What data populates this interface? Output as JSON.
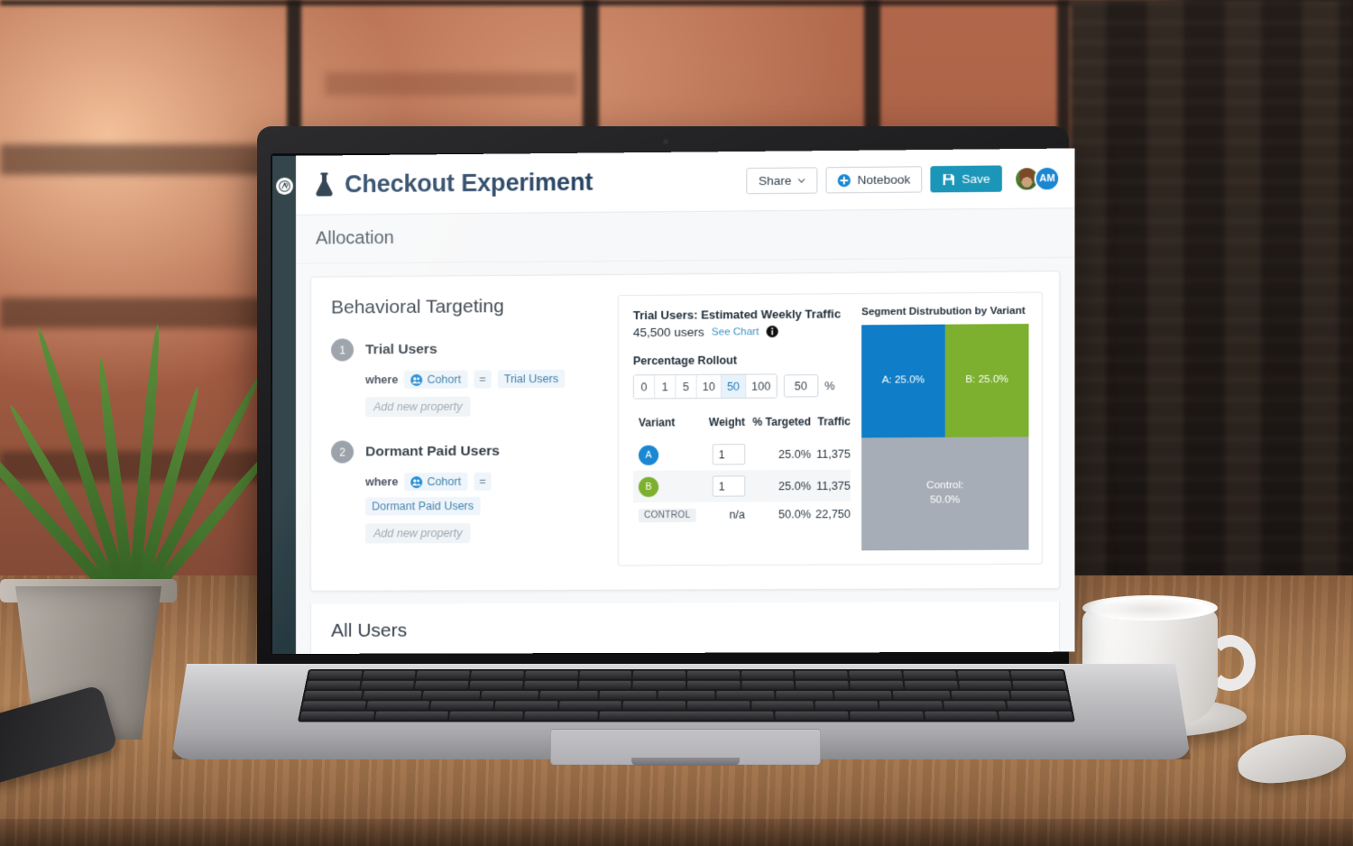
{
  "rail": {
    "logo_label": "A"
  },
  "header": {
    "title": "Checkout Experiment",
    "flask_icon": "flask-icon",
    "share_label": "Share",
    "notebook_label": "Notebook",
    "save_label": "Save",
    "avatars": [
      {
        "name": "avatar-photo",
        "initials": ""
      },
      {
        "name": "avatar-am",
        "initials": "AM"
      }
    ],
    "accent_save": "#1c96b8",
    "accent_title": "#1b3a5c"
  },
  "section": {
    "title": "Allocation"
  },
  "targeting": {
    "heading": "Behavioral Targeting",
    "rules": [
      {
        "step": "1",
        "name": "Trial Users",
        "keyword": "where",
        "property": "Cohort",
        "operator": "=",
        "value": "Trial Users",
        "add_property": "Add new property"
      },
      {
        "step": "2",
        "name": "Dormant Paid Users",
        "keyword": "where",
        "property": "Cohort",
        "operator": "=",
        "value": "Dormant Paid Users",
        "add_property": "Add new property"
      }
    ]
  },
  "allocation": {
    "traffic_heading": "Trial Users: Estimated Weekly Traffic",
    "traffic_users": "45,500 users",
    "see_chart": "See Chart",
    "info_icon": "info-icon",
    "rollout_label": "Percentage Rollout",
    "rollout_options": [
      "0",
      "1",
      "5",
      "10",
      "50",
      "100"
    ],
    "rollout_selected": "50",
    "rollout_input_value": "50",
    "rollout_unit": "%",
    "table": {
      "columns": [
        "Variant",
        "Weight",
        "% Targeted",
        "Traffic"
      ],
      "rows": [
        {
          "variant": "A",
          "type": "dot",
          "color": "#1b87d2",
          "weight": "1",
          "weight_editable": true,
          "targeted": "25.0%",
          "traffic": "11,375"
        },
        {
          "variant": "B",
          "type": "dot",
          "color": "#7cb02e",
          "weight": "1",
          "weight_editable": true,
          "targeted": "25.0%",
          "traffic": "11,375"
        },
        {
          "variant": "CONTROL",
          "type": "pill",
          "color": "#eef1f4",
          "weight": "n/a",
          "weight_editable": false,
          "targeted": "50.0%",
          "traffic": "22,750"
        }
      ]
    }
  },
  "chart_data": {
    "type": "treemap",
    "title": "Segment Distrubution by Variant",
    "categories": [
      "A",
      "B",
      "Control"
    ],
    "values": [
      25.0,
      25.0,
      50.0
    ],
    "labels": [
      "A: 25.0%",
      "B: 25.0%",
      "Control:\n50.0%"
    ],
    "colors": [
      "#0f7dc8",
      "#7cb02e",
      "#a6adb6"
    ],
    "unit": "%",
    "total": 100.0,
    "legend": "none",
    "grid": false,
    "cells": [
      {
        "label": "A: 25.0%",
        "value": 25.0,
        "color": "#0f7dc8"
      },
      {
        "label": "B: 25.0%",
        "value": 25.0,
        "color": "#7cb02e"
      },
      {
        "label_line1": "Control:",
        "label_line2": "50.0%",
        "value": 50.0,
        "color": "#a6adb6"
      }
    ]
  },
  "next_section": {
    "title": "All Users"
  }
}
